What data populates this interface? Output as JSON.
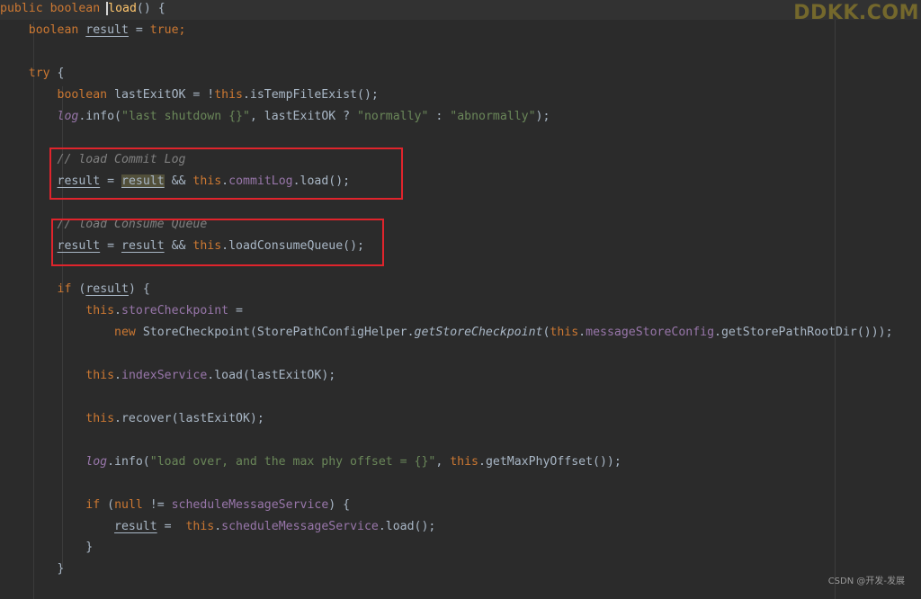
{
  "code": {
    "l1": {
      "kw_public": "public",
      "kw_boolean": "boolean",
      "method": "load",
      "rest": "() {"
    },
    "l2": {
      "kw_boolean": "boolean",
      "var_result": "result",
      "op": " = ",
      "kw_true": "true",
      "semi": ";"
    },
    "l4": {
      "kw_try": "try",
      "rest": " {"
    },
    "l5": {
      "kw_boolean": "boolean",
      "var": " lastExitOK = !",
      "kw_this": "this",
      "call": ".isTempFileExist();"
    },
    "l6": {
      "field_log": "log",
      "call": ".info(",
      "str1": "\"last shutdown {}\"",
      "mid": ", lastExitOK ? ",
      "str2": "\"normally\"",
      "colon": " : ",
      "str3": "\"abnormally\"",
      "end": ");"
    },
    "l8": {
      "comment": "// load Commit Log"
    },
    "l9": {
      "var_result": "result",
      "op": " = ",
      "var_result2": "result",
      "and": " && ",
      "kw_this": "this",
      "dot": ".",
      "field": "commitLog",
      "call": ".load();"
    },
    "l11": {
      "comment": "// load Consume Queue"
    },
    "l12": {
      "var_result": "result",
      "op": " = ",
      "var_result2": "result",
      "and": " && ",
      "kw_this": "this",
      "call": ".loadConsumeQueue();"
    },
    "l14": {
      "kw_if": "if",
      "open": " (",
      "var_result": "result",
      "close": ") {"
    },
    "l15": {
      "kw_this": "this",
      "dot": ".",
      "field": "storeCheckpoint",
      "op": " ="
    },
    "l16": {
      "kw_new": "new",
      "cls": " StoreCheckpoint(StorePathConfigHelper.",
      "static_call": "getStoreCheckpoint",
      "open": "(",
      "kw_this": "this",
      "dot": ".",
      "field": "messageStoreConfig",
      "end": ".getStorePathRootDir()));"
    },
    "l18": {
      "kw_this": "this",
      "dot": ".",
      "field": "indexService",
      "call": ".load(lastExitOK);"
    },
    "l20": {
      "kw_this": "this",
      "call": ".recover(lastExitOK);"
    },
    "l22": {
      "field_log": "log",
      "call": ".info(",
      "str": "\"load over, and the max phy offset = {}\"",
      "mid": ", ",
      "kw_this": "this",
      "end": ".getMaxPhyOffset());"
    },
    "l24": {
      "kw_if": "if",
      "open": " (",
      "kw_null": "null",
      "neq": " != ",
      "field": "scheduleMessageService",
      "close": ") {"
    },
    "l25": {
      "var_result": "result",
      "op": " =  ",
      "kw_this": "this",
      "dot": ".",
      "field": "scheduleMessageService",
      "call": ".load();"
    },
    "l26": {
      "brace": "}"
    },
    "l27": {
      "brace": "}"
    }
  },
  "watermarks": {
    "top_right": "DDKK.COM",
    "csdn": "CSDN @开发-发展"
  },
  "colors": {
    "background": "#2b2b2b",
    "keyword": "#cc7832",
    "field": "#9876aa",
    "string": "#6a8759",
    "comment": "#808080",
    "text": "#a9b7c6",
    "highlight_box": "#e0242c"
  }
}
